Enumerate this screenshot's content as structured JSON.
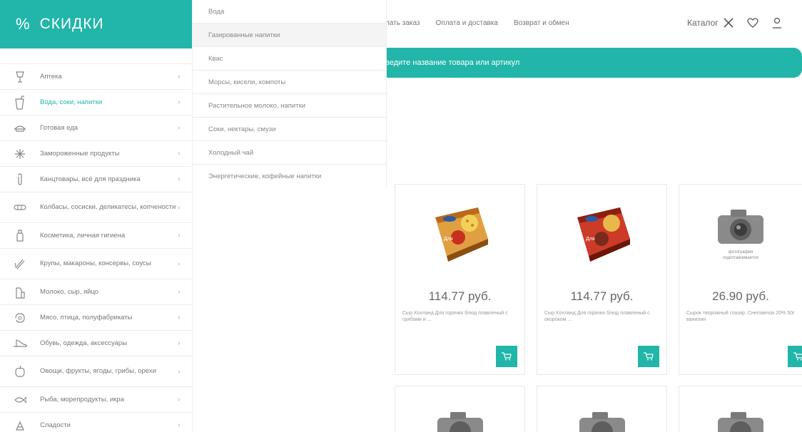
{
  "header": {
    "nav_links": [
      "лать заказ",
      "Оплата и доставка",
      "Возврат и обмен"
    ],
    "catalog_label": "Каталог"
  },
  "search": {
    "placeholder": "ведите название товара или артикул"
  },
  "category_panel": {
    "percent_symbol": "%",
    "title": "СКИДКИ",
    "items": [
      {
        "label": "Аптека",
        "icon": "pharmacy-icon"
      },
      {
        "label": "Вода, соки, напитки",
        "icon": "drink-cup-icon",
        "active": true
      },
      {
        "label": "Готовая еда",
        "icon": "ready-food-icon"
      },
      {
        "label": "Замороженные продукты",
        "icon": "snowflake-icon"
      },
      {
        "label": "Канцтовары, всё для праздника",
        "icon": "paperclip-icon"
      },
      {
        "label": "Колбасы, сосиски, деликатесы, копчености",
        "icon": "sausage-icon"
      },
      {
        "label": "Косметика, личная гигиена",
        "icon": "cosmetics-bottle-icon"
      },
      {
        "label": "Крупы, макароны, консервы, соусы",
        "icon": "pasta-icon"
      },
      {
        "label": "Молоко, сыр, яйцо",
        "icon": "milk-icon"
      },
      {
        "label": "Мясо, птица, полуфабрикаты",
        "icon": "meat-icon"
      },
      {
        "label": "Обувь, одежда, аксессуары",
        "icon": "shoe-icon"
      },
      {
        "label": "Овощи, фрукты, ягоды, грибы, орехи",
        "icon": "fruit-icon"
      },
      {
        "label": "Рыба, морепродукты, икра",
        "icon": "fish-icon"
      },
      {
        "label": "Сладости",
        "icon": "sweets-icon"
      }
    ]
  },
  "submenu": {
    "items": [
      "Вода",
      "Газированные напитки",
      "Квас",
      "Морсы, кисели, компоты",
      "Растительное молоко, напитки",
      "Соки, нектары, смузи",
      "Холодный чай",
      "Энергетические, кофейные напитки"
    ]
  },
  "products": [
    {
      "price": "114.77 руб.",
      "desc": "Сыр Хохланд Для горячих блюд плавленый с грибами и ...",
      "image": "cheese-package-orange"
    },
    {
      "price": "114.77 руб.",
      "desc": "Сыр Хохланд Для горячих блюд плавленый с окороком ...",
      "image": "cheese-package-red"
    },
    {
      "price": "26.90 руб.",
      "desc": "Сырок творожный глазир. Снеговичок 20% 50г ванилин",
      "image": "camera-placeholder",
      "photo_note": "фотография подготавливается"
    }
  ],
  "colors": {
    "accent": "#22b5a9"
  }
}
